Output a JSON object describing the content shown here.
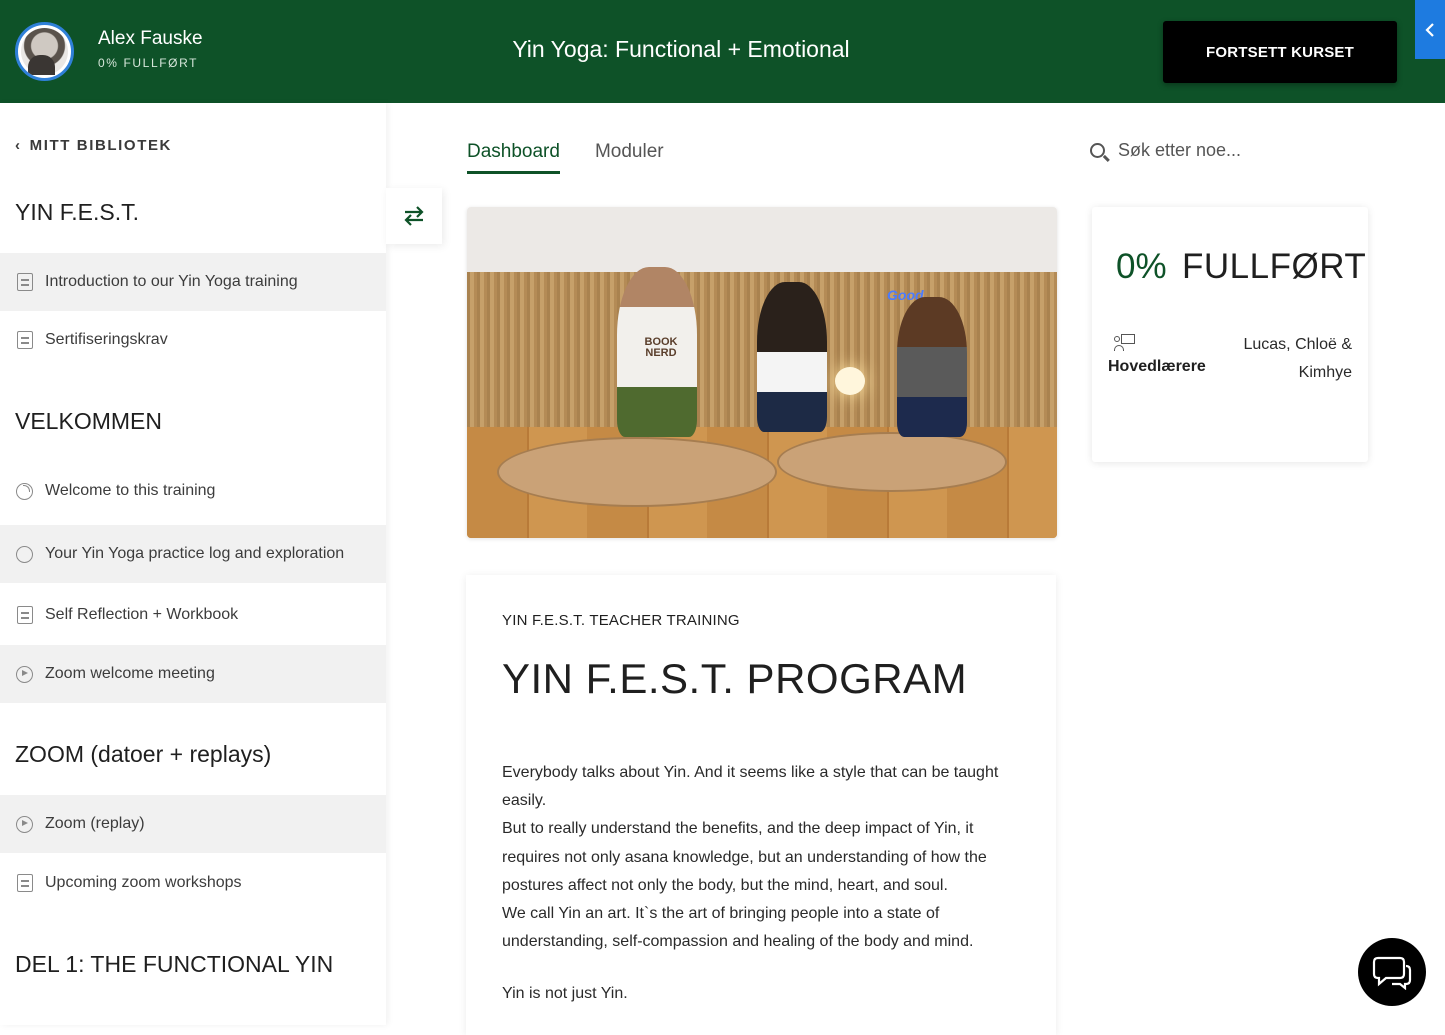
{
  "header": {
    "user_name": "Alex Fauske",
    "user_progress": "0% FULLFØRT",
    "course_title": "Yin Yoga: Functional + Emotional",
    "continue_label": "FORTSETT KURSET",
    "collapse_icon": "chevron-left-icon",
    "background_color": "#0e5228",
    "accent_color": "#1e7be0"
  },
  "sidebar": {
    "back_label": "MITT BIBLIOTEK",
    "sections": [
      {
        "title": "YIN F.E.S.T.",
        "lessons": [
          {
            "label": "Introduction to our Yin Yoga training",
            "icon": "document-icon"
          },
          {
            "label": "Sertifiseringskrav",
            "icon": "document-icon"
          }
        ]
      },
      {
        "title": "VELKOMMEN",
        "lessons": [
          {
            "label": "Welcome to this training",
            "icon": "progress-circle-icon"
          },
          {
            "label": "Your Yin Yoga practice log and exploration",
            "icon": "circle-icon"
          },
          {
            "label": "Self Reflection + Workbook",
            "icon": "document-icon"
          },
          {
            "label": "Zoom welcome meeting",
            "icon": "play-circle-icon"
          }
        ]
      },
      {
        "title": "ZOOM (datoer + replays)",
        "lessons": [
          {
            "label": "Zoom (replay)",
            "icon": "play-circle-icon"
          },
          {
            "label": "Upcoming zoom workshops",
            "icon": "document-icon"
          }
        ]
      },
      {
        "title": "DEL 1: THE FUNCTIONAL YIN",
        "lessons": []
      }
    ]
  },
  "main": {
    "tabs": [
      {
        "label": "Dashboard",
        "active": true
      },
      {
        "label": "Moduler",
        "active": false
      }
    ],
    "search_placeholder": "Søk etter noe...",
    "progress": {
      "percent": "0%",
      "label": "FULLFØRT",
      "teachers_label": "Hovedlærere",
      "teachers": "Lucas, Chloë & Kimhye"
    },
    "content": {
      "eyebrow": "YIN F.E.S.T. TEACHER TRAINING",
      "title": "YIN F.E.S.T. PROGRAM",
      "paragraphs": [
        "Everybody talks about Yin. And it seems like a style that can be taught easily.",
        "But to really understand the benefits, and the deep impact of Yin, it requires not only asana knowledge, but an understanding of how the postures affect not only the body, but the mind, heart, and soul.",
        "We call Yin an art. It`s the art of bringing people into a state of understanding, self-compassion and healing of the body and mind."
      ],
      "tail": "Yin is not just Yin."
    },
    "hero_shirt_text": "BOOK NERD"
  }
}
